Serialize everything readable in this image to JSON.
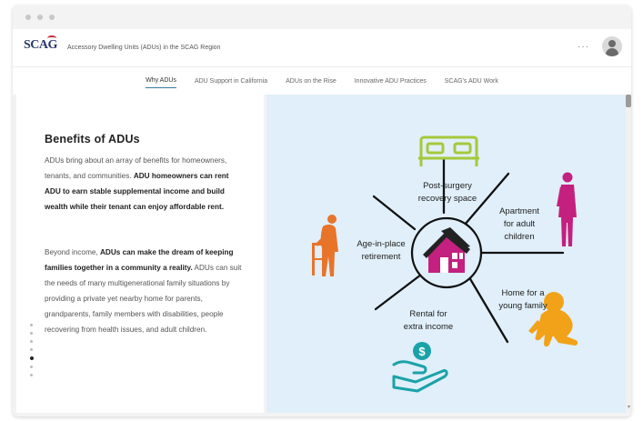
{
  "app": {
    "logo_text": "SCAG",
    "title": "Accessory Dwelling Units (ADUs) in the SCAG Region",
    "more_label": "···"
  },
  "tabs": [
    {
      "label": "Why ADUs",
      "active": true
    },
    {
      "label": "ADU Support in California",
      "active": false
    },
    {
      "label": "ADUs on the Rise",
      "active": false
    },
    {
      "label": "Innovative ADU Practices",
      "active": false
    },
    {
      "label": "SCAG's ADU Work",
      "active": false
    }
  ],
  "content": {
    "heading": "Benefits of ADUs",
    "p1_normal": "ADUs bring about an array of benefits for homeowners, tenants, and communities. ",
    "p1_bold": "ADU homeowners can rent ADU to earn stable supplemental income and build wealth while their tenant can enjoy affordable rent.",
    "p2_normal_a": "Beyond income, ",
    "p2_bold": "ADUs can make the dream of keeping families together in a community a reality.",
    "p2_normal_b": " ADUs can suit the needs of many multigenerational family situations by providing a private yet nearby home for parents, grandparents, family members with disabilities, people recovering from health issues, and adult children."
  },
  "diagram": {
    "labels": {
      "post_surgery_1": "Post-surgery",
      "post_surgery_2": "recovery space",
      "apartment_1": "Apartment",
      "apartment_2": "for adult",
      "apartment_3": "children",
      "age_1": "Age-in-place",
      "age_2": "retirement",
      "home_1": "Home for a",
      "home_2": "young family",
      "rental_1": "Rental for",
      "rental_2": "extra income"
    },
    "colors": {
      "bed": "#a6c93a",
      "adult": "#c4207f",
      "elder": "#e8742a",
      "baby": "#f2a218",
      "money": "#1ba2a8",
      "house_roof": "#222222",
      "house_wall": "#c4207f"
    }
  },
  "pager": {
    "count": 7,
    "active_index": 4
  }
}
